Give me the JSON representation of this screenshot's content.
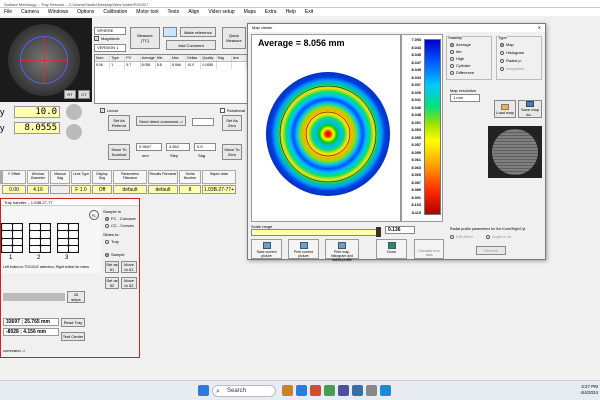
{
  "app": {
    "title": "Surface Metrology – Tray Session – C:\\Users\\Studio\\Desktop\\New folder\\PG0327",
    "menu": [
      "File",
      "Camera",
      "Windows",
      "Options",
      "Calibration",
      "Motor tool",
      "Tests",
      "Align",
      "Video setup",
      "Maps",
      "Extra",
      "Help",
      "Exit"
    ]
  },
  "camera": {
    "btn_a": "RT",
    "btn_b": "CT"
  },
  "readouts": [
    {
      "axis": "y",
      "value": "10.0"
    },
    {
      "axis": "y",
      "value": "8.0555"
    }
  ],
  "controls": {
    "sphere_select": "SPHERE",
    "magnitude_label": "Magnitude",
    "mag_select": "VERSION 1",
    "version_select": "VERSION 1",
    "measure_btn": "Measure\n[TC]",
    "make_reference": "Make reference",
    "add_comment": "Add Comment",
    "quick_measure": "Quick\nMeasure",
    "linear_label": "Linear",
    "rotational_label": "Rotational",
    "send_direct": "Send direct command ->",
    "set_as_reference": "Set As\nRefernd",
    "set_as_zero": "Set As\nZero",
    "move_to_nominal": "Move To\nNominal",
    "nominal_val": "0.9547",
    "step_val": "3.562",
    "unit_mm": "mm",
    "step_label": "Step",
    "sag_label": "Sag",
    "move_to_zero": "Move To\nZero",
    "value_0_5": "0.5"
  },
  "table": {
    "headers": [
      "Nom",
      "Type",
      "PV",
      "Average",
      "Min",
      "Max",
      "Deltas",
      "Quality",
      "Sag",
      "Ave"
    ],
    "rows": [
      [
        "5.06",
        "1",
        "5.7",
        "8.055",
        "8.8",
        "8.966",
        "10.0",
        "0.0085",
        "",
        ""
      ]
    ]
  },
  "params": {
    "headers": [
      "Y Offset",
      "Window Diameter",
      "Manual Sag",
      "Lens Type",
      "Display Seg",
      "Parameters Filename",
      "Results Filename",
      "Serial Number",
      "Bspec data"
    ],
    "values": [
      "0.00",
      "4.16",
      "",
      "F 1.0",
      "Off",
      "default",
      "default",
      "8",
      "1.03B.27-77+"
    ]
  },
  "tray": {
    "title": "Tray handler – 1.03B.27-77",
    "fl_label": "FL",
    "sample_label": "Sample to",
    "opt_concave": "FC - Concave",
    "opt_convex": "CC - Convex",
    "slides_label": "Slides to:",
    "opt_tray": "Tray",
    "opt_sample": "Sample",
    "set_as_1": "Set as\n61",
    "move_to_1": "Move\nto 61",
    "set_as_2": "Set as\n52",
    "move_to_2": "Move\nto 52",
    "hint": "Left button to TOGGLE selection, Right button for menu",
    "columns": [
      "1",
      "2",
      "3"
    ],
    "steps_val": "26",
    "steps_label": "steps",
    "pos1": "33697 ; 25.765 mm",
    "pos2": "-8028 ; 4.156 mm",
    "read_tray": "Read Tray",
    "test_center": "Test Center",
    "command": "command ->"
  },
  "map": {
    "window_title": "Map viewer",
    "average_label": "Average = 8.056 mm",
    "colorbar_labels": [
      "7.093",
      "8.043",
      "8.045",
      "8.047",
      "8.049",
      "8.033",
      "8.037",
      "8.039",
      "8.041",
      "8.046",
      "8.048",
      "8.051",
      "8.053",
      "8.055",
      "8.057",
      "8.059",
      "8.061",
      "8.063",
      "8.065",
      "8.087",
      "8.089",
      "8.091",
      "8.103",
      "8.115"
    ],
    "scale_label": "Scale range",
    "scale_value": "0.136",
    "buttons": [
      "Save current picture",
      "Print current picture",
      "Print map, histogram and radius profile",
      "Close",
      "Calculate lens' data"
    ],
    "stability_label": "Stability",
    "stability_opts": [
      "Average",
      "Iter",
      "High",
      "Cylinder",
      "Difference"
    ],
    "type_label": "Type",
    "type_opts": [
      "Map",
      "Histogram",
      "Radial p.",
      "Integrated"
    ],
    "map_resolution_label": "Map resolution",
    "map_resolution_val": "1 mm",
    "load_map": "Load map",
    "save_map": "Save map as...",
    "radial_params_label": "Radial profile parameters for the Kone/High/Cyl",
    "radial_param_hint": "Diff offset",
    "radial_param2": "Angle in Ar",
    "radial_btn": "Refresh",
    "stability_selected": 0,
    "type_selected": 0
  },
  "taskbar": {
    "search": "Search",
    "time": "3:27 PM",
    "date": "4/4/2024"
  }
}
